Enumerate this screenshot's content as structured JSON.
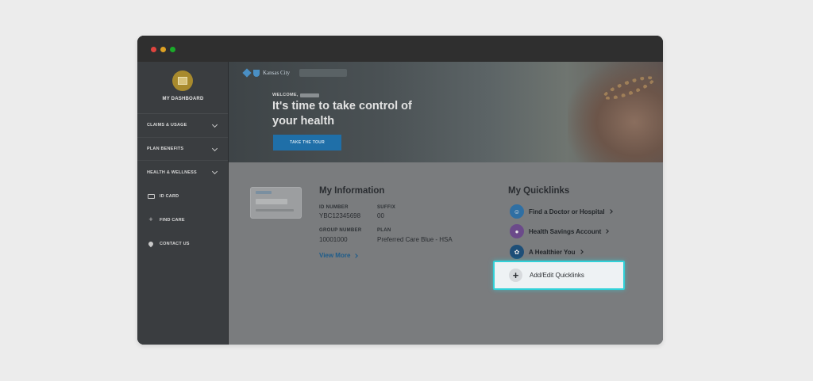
{
  "sidebar": {
    "dashboard_label": "MY DASHBOARD",
    "menu": [
      {
        "label": "CLAIMS & USAGE",
        "icon": "chevron-down-icon"
      },
      {
        "label": "PLAN BENEFITS",
        "icon": "chevron-down-icon"
      },
      {
        "label": "HEALTH & WELLNESS",
        "icon": "chevron-down-icon"
      }
    ],
    "links": [
      {
        "label": "ID CARD",
        "icon": "id-card-icon"
      },
      {
        "label": "FIND CARE",
        "icon": "plus-icon"
      },
      {
        "label": "CONTACT US",
        "icon": "location-pin-icon"
      }
    ]
  },
  "hero": {
    "brand": "Kansas City",
    "welcome": "WELCOME,",
    "title": "It's time to take control of your health",
    "cta": "TAKE THE TOUR"
  },
  "my_information": {
    "title": "My Information",
    "id_number_label": "ID NUMBER",
    "id_number": "YBC12345698",
    "suffix_label": "SUFFIX",
    "suffix": "00",
    "group_number_label": "GROUP NUMBER",
    "group_number": "10001000",
    "plan_label": "PLAN",
    "plan": "Preferred Care Blue - HSA",
    "view_more": "View More"
  },
  "quicklinks": {
    "title": "My Quicklinks",
    "items": [
      {
        "label": "Find a Doctor or Hospital",
        "icon": "doctor-icon",
        "color": "#2f6fa3"
      },
      {
        "label": "Health Savings Account",
        "icon": "piggy-bank-icon",
        "color": "#6b4a8a"
      },
      {
        "label": "A Healthier You",
        "icon": "lungs-icon",
        "color": "#1e4f78"
      }
    ],
    "add_edit": "Add/Edit Quicklinks"
  },
  "colors": {
    "highlight": "#31d1d8",
    "cta": "#1f6fa8",
    "link": "#1e5c8a"
  }
}
